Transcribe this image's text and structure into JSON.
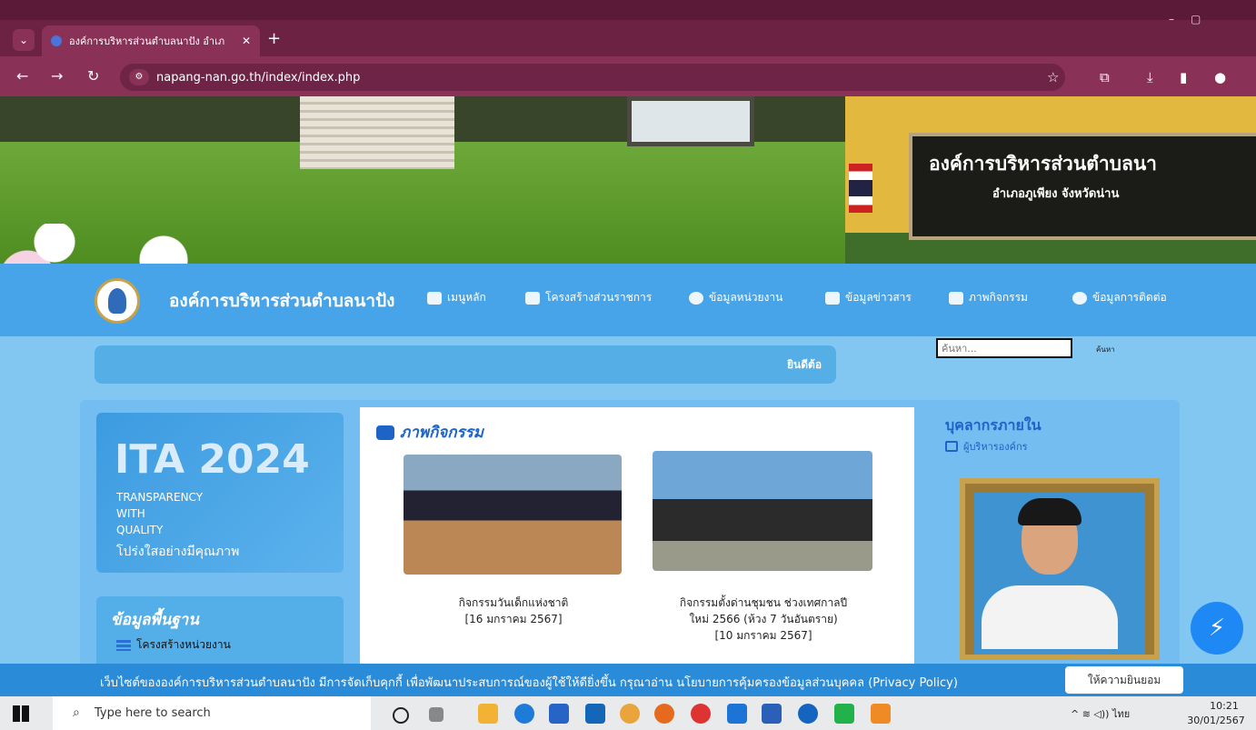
{
  "browser": {
    "tab_title": "องค์การบริหารส่วนตำบลนาปัง อำเภ",
    "tab_close": "✕",
    "new_tab": "+",
    "url": "napang-nan.go.th/index/index.php"
  },
  "banner": {
    "sign_line1": "องค์การบริหารส่วนตำบลนา",
    "sign_line2": "อำเภอภูเพียง  จังหวัดน่าน"
  },
  "site": {
    "title": "องค์การบริหารส่วนตำบลนาปัง",
    "nav": [
      {
        "label": "เมนูหลัก"
      },
      {
        "label": "โครงสร้างส่วนราชการ"
      },
      {
        "label": "ข้อมูลหน่วยงาน"
      },
      {
        "label": "ข้อมูลข่าวสาร"
      },
      {
        "label": "ภาพกิจกรรม"
      },
      {
        "label": "ข้อมูลการติดต่อ"
      }
    ]
  },
  "marquee": {
    "text": "ยินดีต้อ"
  },
  "search": {
    "placeholder": "ค้นหา...",
    "button": "ค้นหา"
  },
  "ita": {
    "title": "ITA 2024",
    "line1": "TRANSPARENCY",
    "line2": "WITH",
    "line3": "QUALITY",
    "thai": "โปร่งใสอย่างมีคุณภาพ"
  },
  "basic_info": {
    "title": "ข้อมูลพื้นฐาน",
    "item": "โครงสร้างหน่วยงาน"
  },
  "activities": {
    "title": "ภาพกิจกรรม",
    "items": [
      {
        "caption_line1": "กิจกรรมวันเด็กแห่งชาติ",
        "caption_line2": "[16 มกราคม 2567]"
      },
      {
        "caption_line1": "กิจกรรมตั้งด่านชุมชน ช่วงเทศกาลปี",
        "caption_line2": "ใหม่ 2566 (ห้วง 7 วันอันตราย)",
        "caption_line3": "[10 มกราคม 2567]"
      }
    ]
  },
  "staff": {
    "title": "บุคลากรภายใน",
    "subtitle": "ผู้บริหารองค์กร"
  },
  "cookie": {
    "text": "เว็บไซต์ขององค์การบริหารส่วนตำบลนาปัง มีการจัดเก็บคุกกี้ เพื่อพัฒนาประสบการณ์ของผู้ใช้ให้ดียิ่งขึ้น กรุณาอ่าน นโยบายการคุ้มครองข้อมูลส่วนบุคคล (Privacy Policy)",
    "accept": "ให้ความยินยอม"
  },
  "taskbar": {
    "search_placeholder": "Type here to search",
    "lang": "ไทย",
    "time": "10:21",
    "date": "30/01/2567"
  },
  "colors": {
    "browser_frame": "#8a3157",
    "nav_blue": "#47a4e8",
    "content_blue": "#82c6f2",
    "heading_blue": "#1e63c6",
    "cookie_bar": "#2a8bd8"
  }
}
